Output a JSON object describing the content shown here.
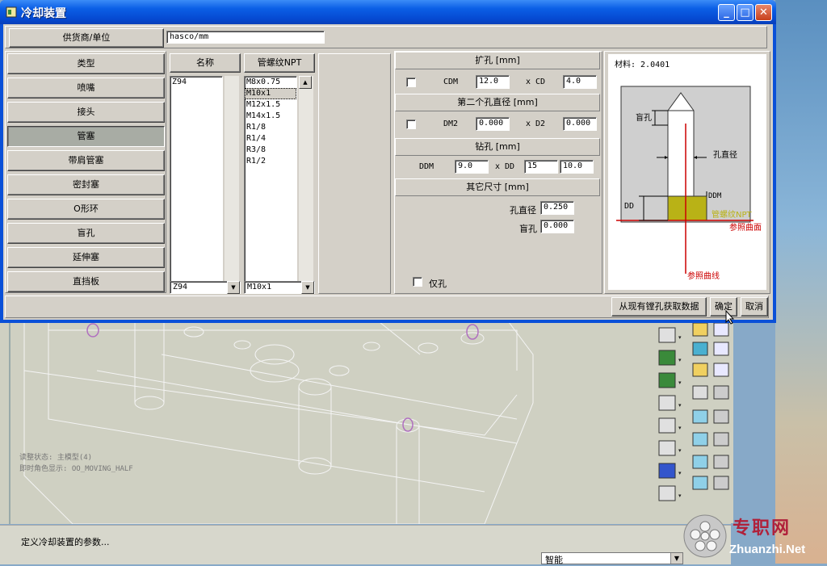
{
  "window": {
    "title": "冷却装置"
  },
  "supplier": {
    "label": "供货商/单位",
    "value": "hasco/mm"
  },
  "categories": [
    {
      "label": "类型",
      "selected": false
    },
    {
      "label": "喷嘴",
      "selected": false
    },
    {
      "label": "接头",
      "selected": false
    },
    {
      "label": "管塞",
      "selected": true
    },
    {
      "label": "带肩管塞",
      "selected": false
    },
    {
      "label": "密封塞",
      "selected": false
    },
    {
      "label": "O形环",
      "selected": false
    },
    {
      "label": "盲孔",
      "selected": false
    },
    {
      "label": "延伸塞",
      "selected": false
    },
    {
      "label": "直挡板",
      "selected": false
    }
  ],
  "name_list": {
    "header": "名称",
    "items": [
      "Z94"
    ],
    "selected_value": "Z94"
  },
  "thread_list": {
    "header": "管螺纹NPT",
    "items": [
      "M8x0.75",
      "M10x1",
      "M12x1.5",
      "M14x1.5",
      "R1/8",
      "R1/4",
      "R3/8",
      "R1/2"
    ],
    "selected_index": 1,
    "selected_value": "M10x1"
  },
  "counterbore": {
    "header": "扩孔 [mm]",
    "cdm_label": "CDM",
    "cdm_value": "12.0",
    "cd_label": "x CD",
    "cd_value": "4.0"
  },
  "second_hole": {
    "header": "第二个孔直径 [mm]",
    "dm2_label": "DM2",
    "dm2_value": "0.000",
    "d2_label": "x D2",
    "d2_value": "0.000"
  },
  "drill": {
    "header": "钻孔 [mm]",
    "ddm_label": "DDM",
    "ddm_value": "9.0",
    "dd_label": "x DD",
    "dd_value": "15",
    "extra_value": "10.0"
  },
  "other": {
    "header": "其它尺寸 [mm]",
    "hole_dia_label": "孔直径",
    "hole_dia_value": "0.250",
    "blind_label": "盲孔",
    "blind_value": "0.000"
  },
  "hole_only": {
    "label": "仅孔"
  },
  "diagram": {
    "material": "材料: 2.0401",
    "blind": "盲孔",
    "hole_dia": "孔直径",
    "dd": "DD",
    "ddm": "DDM",
    "npt": "管螺纹NPT",
    "ref_surface": "参照曲面",
    "ref_curve": "参照曲线"
  },
  "footer": {
    "fetch": "从现有镗孔获取数据",
    "ok": "确定",
    "cancel": "取消"
  },
  "cad_text": {
    "line1": "读整状态: 主模型(4)",
    "line2": "即时角色显示: OO_MOVING_HALF"
  },
  "statusbar": {
    "message": "定义冷却装置的参数...",
    "mode": "智能"
  },
  "watermark": {
    "cn": "专职网",
    "en": "Zhuanzhi.Net"
  },
  "colors": {
    "titlebar": "#0548d0",
    "dialog_bg": "#d4d0c8",
    "plug": "#b9b216",
    "ref_red": "#cc0000",
    "watermark": "#b0213a"
  }
}
